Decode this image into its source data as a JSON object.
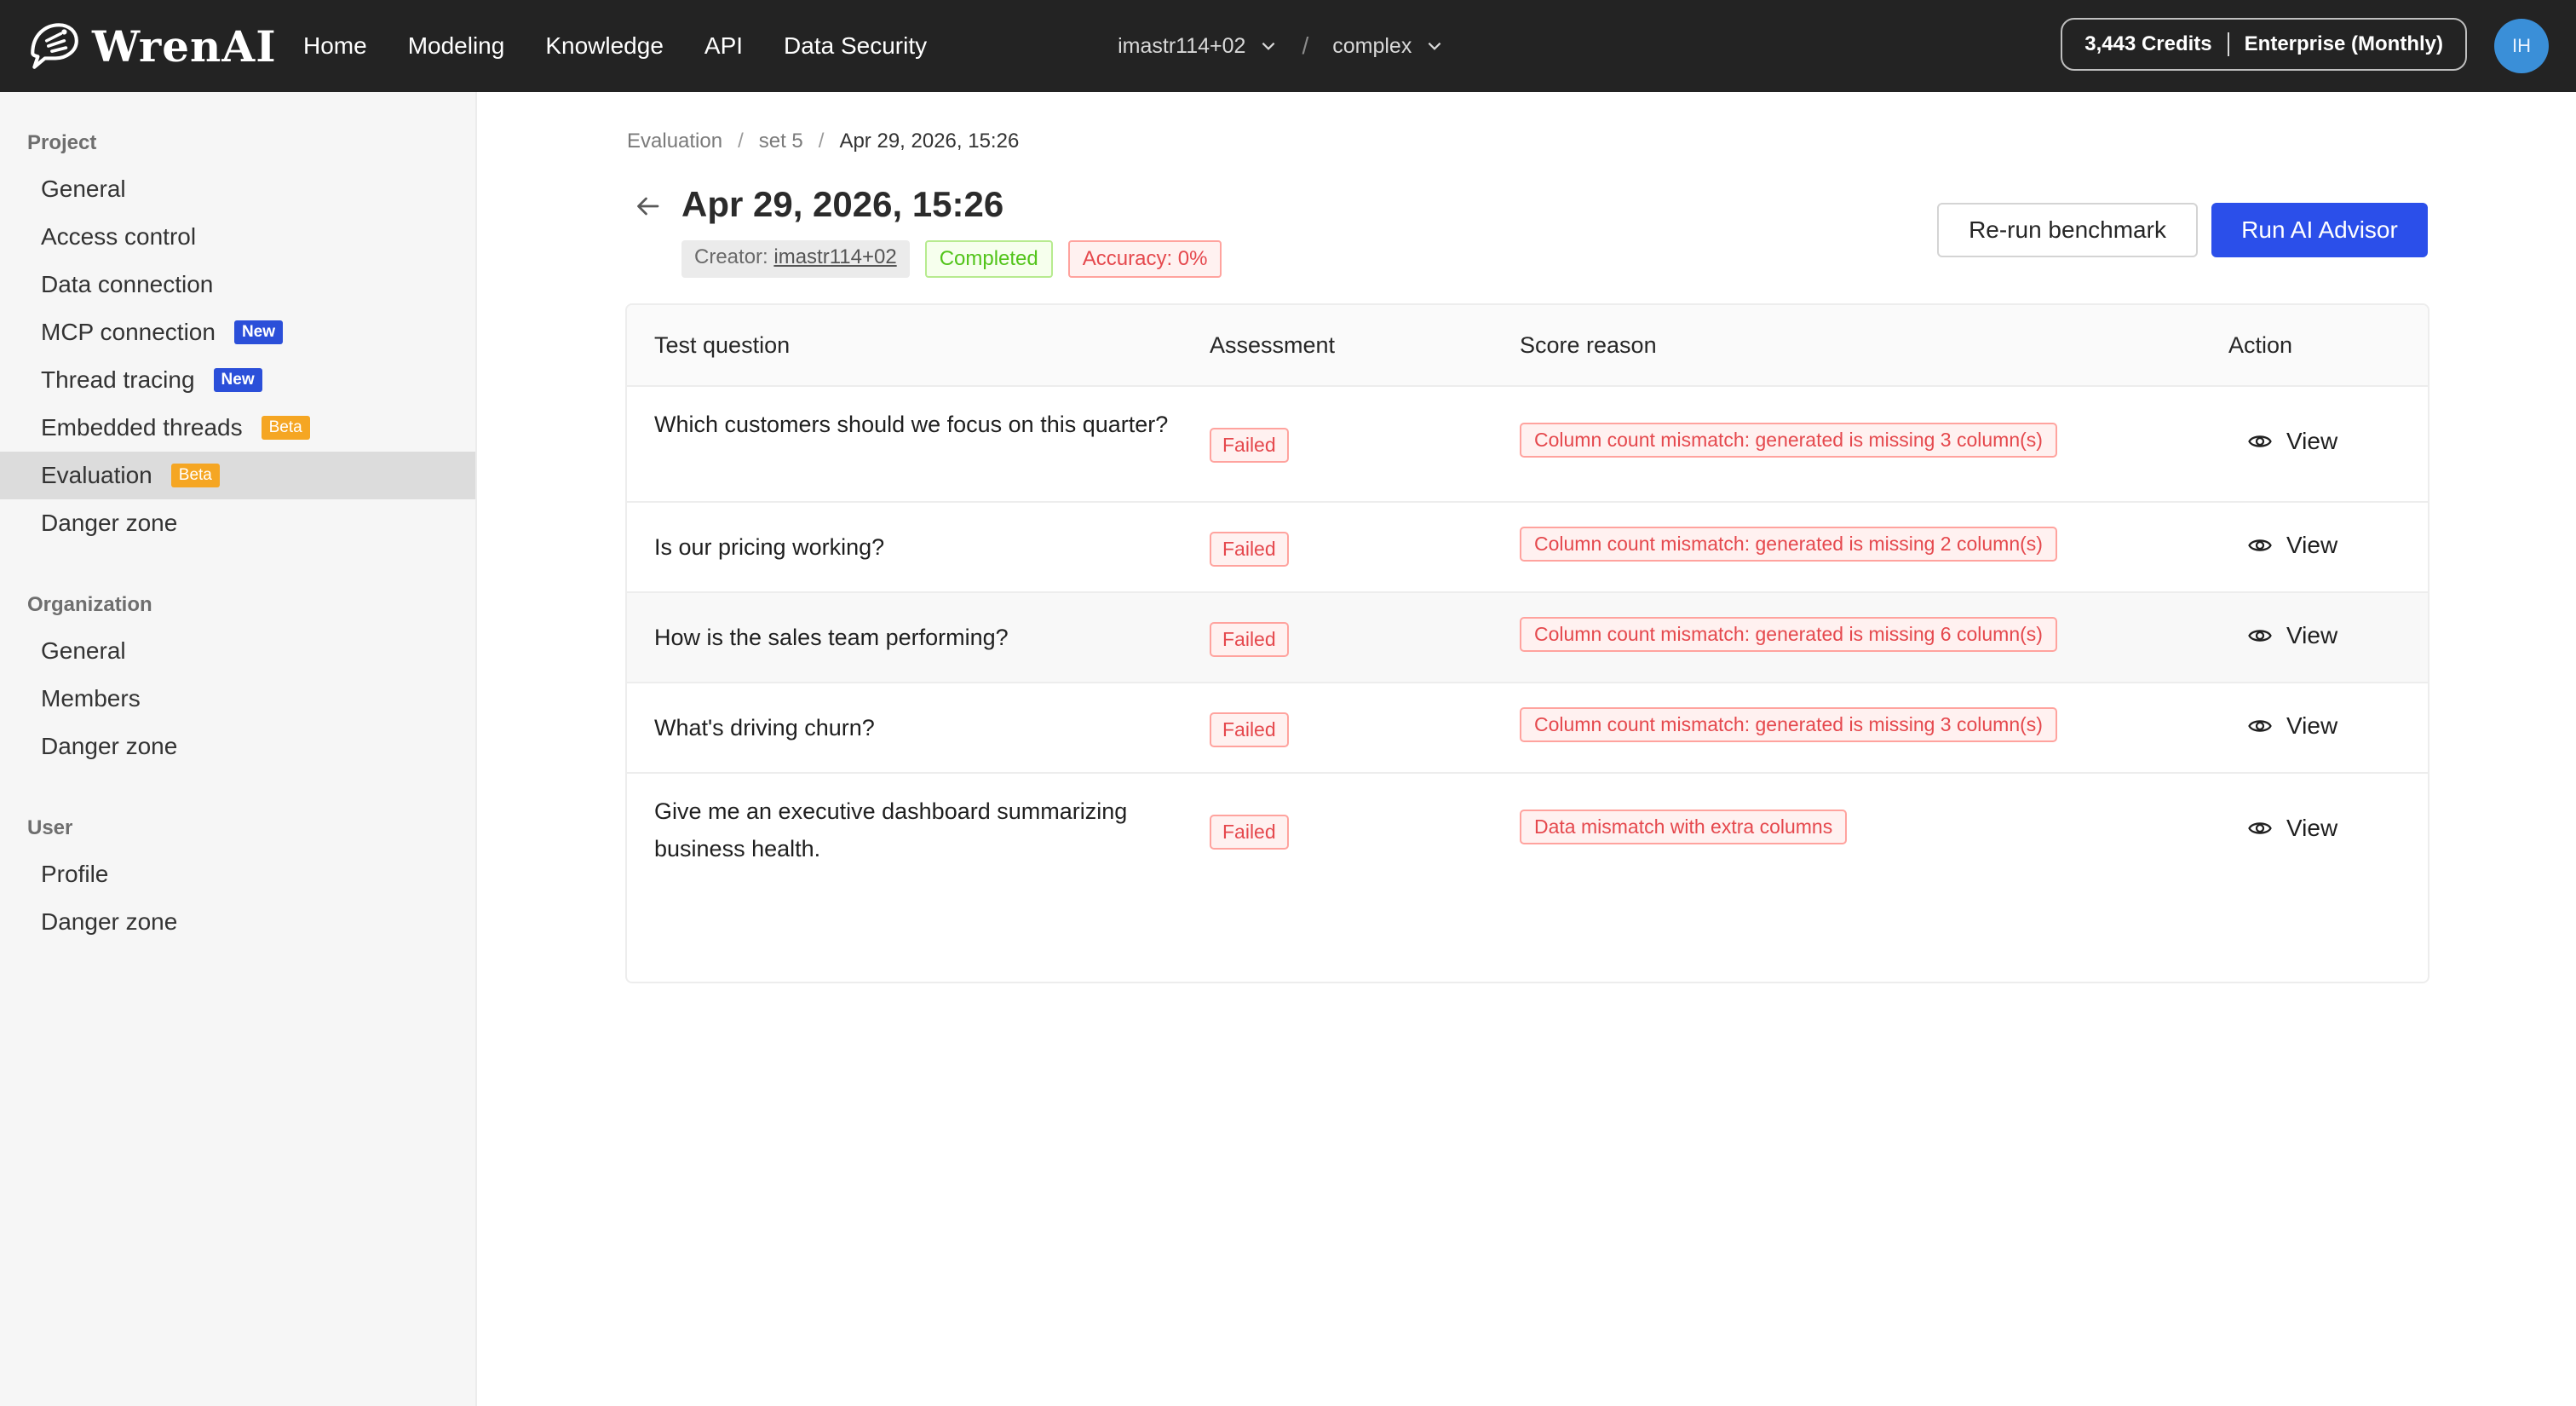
{
  "brand": {
    "name": "WrenAI"
  },
  "nav": {
    "items": [
      "Home",
      "Modeling",
      "Knowledge",
      "API",
      "Data Security"
    ]
  },
  "workspace": {
    "user": "imastr114+02",
    "separator": "/",
    "project": "complex"
  },
  "account": {
    "credits": "3,443 Credits",
    "plan": "Enterprise (Monthly)",
    "avatar_initials": "IH"
  },
  "sidebar": {
    "project": {
      "title": "Project",
      "items": [
        {
          "label": "General"
        },
        {
          "label": "Access control"
        },
        {
          "label": "Data connection"
        },
        {
          "label": "MCP connection",
          "tag": "New"
        },
        {
          "label": "Thread tracing",
          "tag": "New"
        },
        {
          "label": "Embedded threads",
          "tag": "Beta"
        },
        {
          "label": "Evaluation",
          "tag": "Beta",
          "active": true
        },
        {
          "label": "Danger zone"
        }
      ]
    },
    "organization": {
      "title": "Organization",
      "items": [
        {
          "label": "General"
        },
        {
          "label": "Members"
        },
        {
          "label": "Danger zone"
        }
      ]
    },
    "user": {
      "title": "User",
      "items": [
        {
          "label": "Profile"
        },
        {
          "label": "Danger zone"
        }
      ]
    }
  },
  "breadcrumb": {
    "items": [
      "Evaluation",
      "set 5",
      "Apr 29, 2026, 15:26"
    ],
    "separator": "/"
  },
  "page": {
    "title": "Apr 29, 2026, 15:26",
    "creator_label": "Creator:",
    "creator": "imastr114+02",
    "status": "Completed",
    "accuracy": "Accuracy: 0%",
    "rerun_label": "Re-run benchmark",
    "advisor_label": "Run AI Advisor"
  },
  "table": {
    "headers": [
      "Test question",
      "Assessment",
      "Score reason",
      "Action"
    ],
    "rows": [
      {
        "question": "Which customers should we focus on this quarter?",
        "assessment": "Failed",
        "reason": "Column count mismatch: generated is missing 3 column(s)",
        "action": "View"
      },
      {
        "question": "Is our pricing working?",
        "assessment": "Failed",
        "reason": "Column count mismatch: generated is missing 2 column(s)",
        "action": "View"
      },
      {
        "question": "How is the sales team performing?",
        "assessment": "Failed",
        "reason": "Column count mismatch: generated is missing 6 column(s)",
        "action": "View"
      },
      {
        "question": "What's driving churn?",
        "assessment": "Failed",
        "reason": "Column count mismatch: generated is missing 3 column(s)",
        "action": "View"
      },
      {
        "question": "Give me an executive dashboard summarizing business health.",
        "assessment": "Failed",
        "reason": "Data mismatch with extra columns",
        "action": "View"
      }
    ]
  },
  "colors": {
    "primary": "#2b4fea",
    "topbar": "#232323",
    "danger": "#e5484d",
    "success": "#52c41a",
    "beta": "#f5a623"
  }
}
